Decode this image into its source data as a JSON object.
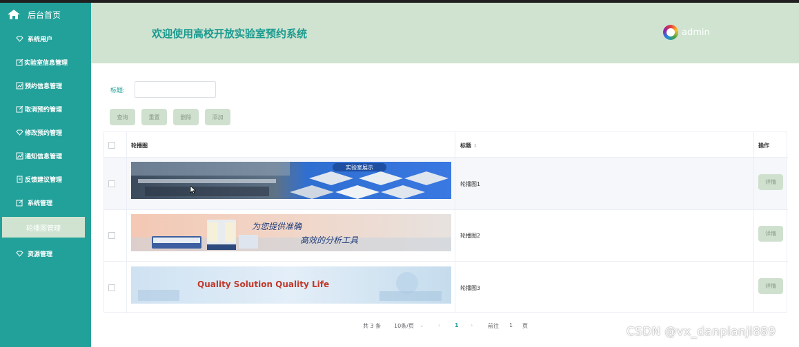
{
  "sidebar": {
    "home_label": "后台首页",
    "items": [
      {
        "label": "系统用户",
        "icon": "diamond-icon"
      },
      {
        "label": "实验室信息管理",
        "icon": "edit-icon"
      },
      {
        "label": "预约信息管理",
        "icon": "chart-icon"
      },
      {
        "label": "取消预约管理",
        "icon": "edit-icon"
      },
      {
        "label": "修改预约管理",
        "icon": "diamond-icon"
      },
      {
        "label": "通知信息管理",
        "icon": "chart-icon"
      },
      {
        "label": "反馈建议管理",
        "icon": "document-icon"
      },
      {
        "label": "系统管理",
        "icon": "edit-icon"
      },
      {
        "label": "轮播图管理",
        "icon": "",
        "active": true
      },
      {
        "label": "资源管理",
        "icon": "diamond-icon"
      }
    ]
  },
  "header": {
    "title": "欢迎使用高校开放实验室预约系统",
    "username": "admin"
  },
  "search": {
    "title_label": "标题:",
    "title_value": "",
    "title_placeholder": ""
  },
  "buttons": {
    "query": "查询",
    "reset": "重置",
    "delete": "删除",
    "add": "添加"
  },
  "table": {
    "columns": [
      "轮播图",
      "标题",
      "操作"
    ],
    "rows": [
      {
        "title": "轮播图1",
        "banner_text": "实验室展示",
        "action": "详情"
      },
      {
        "title": "轮播图2",
        "banner_text_line1": "为您提供准确",
        "banner_text_line2": "高效的分析工具",
        "action": "详情"
      },
      {
        "title": "轮播图3",
        "banner_text": "Quality Solution  Quality Life",
        "action": "详情"
      }
    ]
  },
  "pagination": {
    "total": "共 3 条",
    "page_size": "10条/页",
    "current_page": "1",
    "goto_label": "前往",
    "goto_value": "1",
    "page_suffix": "页"
  },
  "watermark": "CSDN @vx_danpianji889",
  "colors": {
    "sidebar": "#22a19a",
    "header": "#cfe3d0",
    "accent": "#1a9a90",
    "button": "#cfe0cf"
  }
}
